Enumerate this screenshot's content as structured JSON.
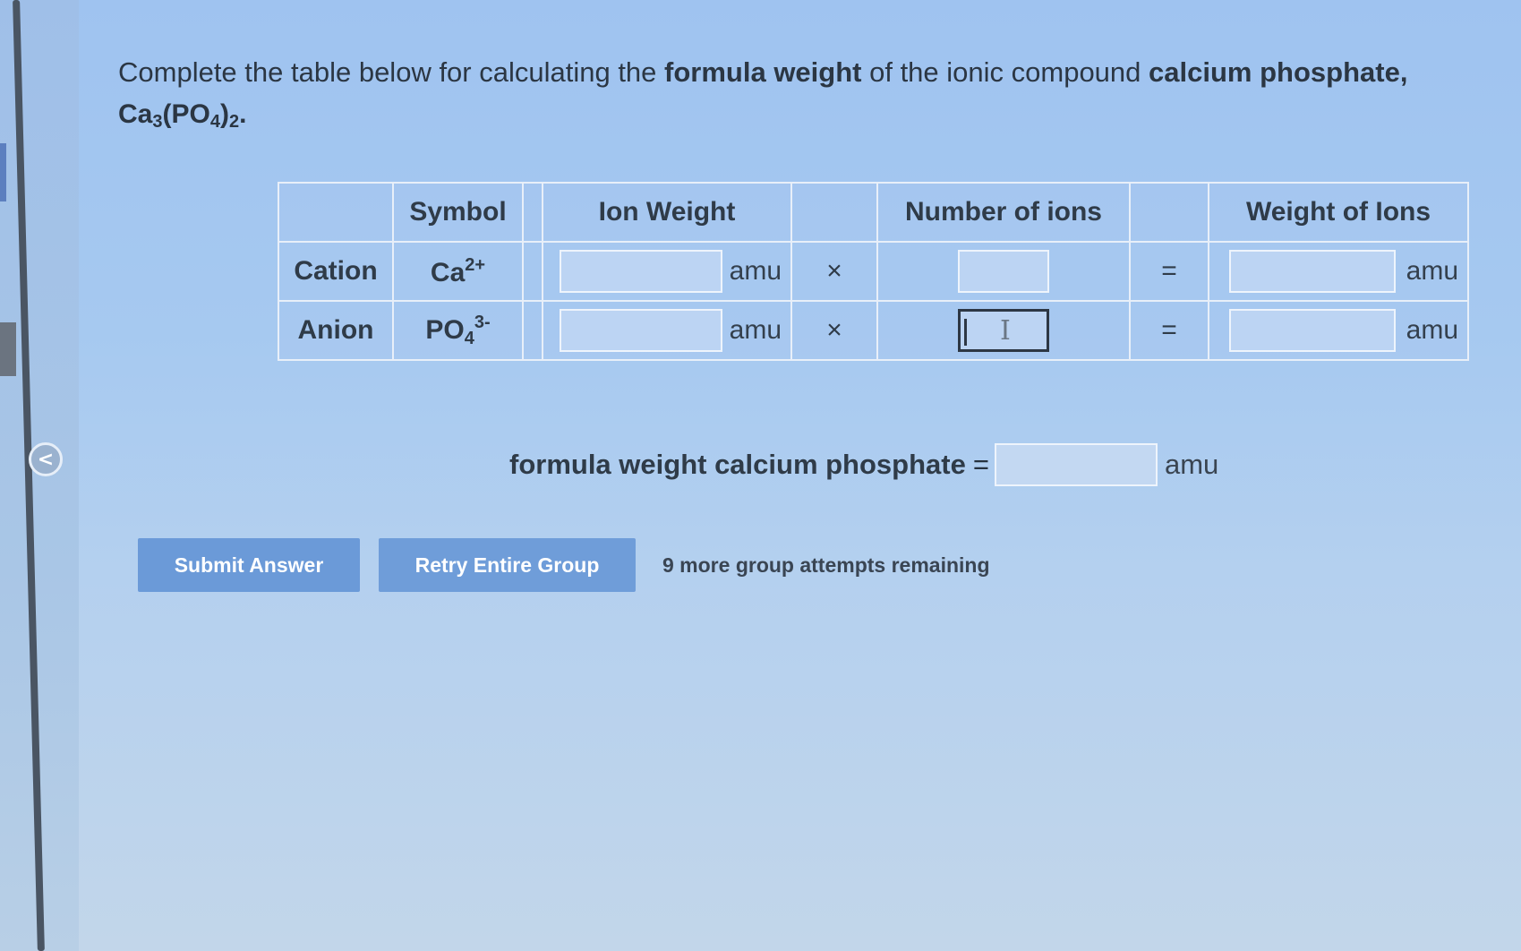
{
  "question": {
    "part1": "Complete the table below for calculating the ",
    "bold1": "formula weight",
    "part2": " of the ionic compound ",
    "bold2": "calcium phosphate,",
    "formula_ca": "Ca",
    "formula_3": "3",
    "formula_po": "(PO",
    "formula_4": "4",
    "formula_close": ")",
    "formula_2": "2",
    "formula_end": "."
  },
  "table": {
    "headers": {
      "symbol": "Symbol",
      "ion_weight": "Ion Weight",
      "number_of_ions": "Number of ions",
      "weight_of_ions": "Weight of Ions"
    },
    "rows": [
      {
        "label": "Cation",
        "symbol_base": "Ca",
        "symbol_sub": "",
        "symbol_charge": "2+",
        "unit": "amu",
        "times": "×",
        "equals": "=",
        "ion_weight_value": "",
        "number_value": "",
        "weight_value": ""
      },
      {
        "label": "Anion",
        "symbol_base": "PO",
        "symbol_sub": "4",
        "symbol_charge": "3-",
        "unit": "amu",
        "times": "×",
        "equals": "=",
        "ion_weight_value": "",
        "number_value": "",
        "weight_value": ""
      }
    ]
  },
  "formula_weight": {
    "label": "formula weight calcium phosphate",
    "equals": "=",
    "value": "",
    "unit": "amu"
  },
  "actions": {
    "submit_label": "Submit Answer",
    "retry_label": "Retry Entire Group",
    "attempts_text": "9 more group attempts remaining"
  },
  "sidebar": {
    "collapse_glyph": "<"
  },
  "colors": {
    "button_bg": "#6b9ad8",
    "background": "#a6c9f0",
    "rail": "#4a5563"
  }
}
